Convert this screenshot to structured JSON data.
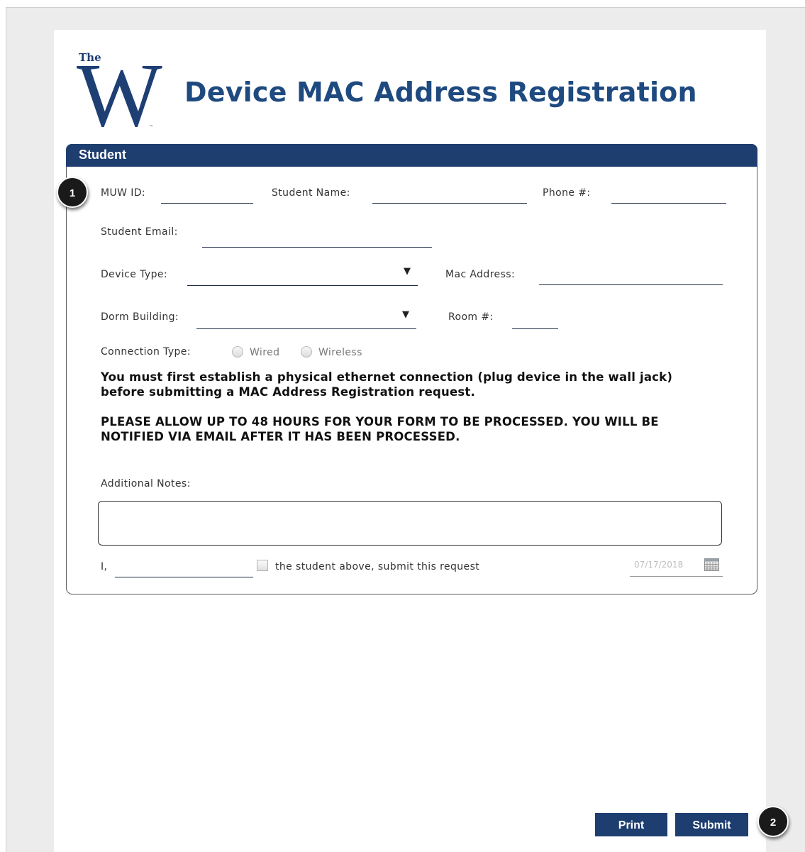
{
  "logo": {
    "top_word": "The",
    "letter": "W",
    "trademark": "™"
  },
  "page_title": "Device MAC Address Registration",
  "panel": {
    "header": "Student"
  },
  "fields": {
    "muw_id_label": "MUW ID:",
    "student_name_label": "Student Name:",
    "phone_label": "Phone #:",
    "student_email_label": "Student Email:",
    "device_type_label": "Device Type:",
    "mac_address_label": "Mac Address:",
    "dorm_building_label": "Dorm Building:",
    "room_label": "Room #:",
    "connection_type_label": "Connection Type:",
    "wired_label": "Wired",
    "wireless_label": "Wireless",
    "additional_notes_label": "Additional Notes:",
    "signature_prefix": "I,",
    "agree_label": "the student above, submit this request",
    "date_value": "07/17/2018"
  },
  "notices": {
    "ethernet_line1": "You must first establish a physical ethernet connection (plug device in the wall jack)",
    "ethernet_line2": "before submitting a MAC Address Registration request.",
    "processing_line1": "PLEASE ALLOW UP TO 48 HOURS FOR YOUR FORM TO BE PROCESSED.  YOU WILL BE",
    "processing_line2": "NOTIFIED VIA EMAIL AFTER IT HAS BEEN PROCESSED."
  },
  "buttons": {
    "print": "Print",
    "submit": "Submit"
  },
  "markers": {
    "one": "1",
    "two": "2"
  },
  "colors": {
    "brand_navy": "#1d3e6f",
    "title_blue": "#1e4a80"
  },
  "icons": {
    "dropdown": "chevron-down-icon",
    "calendar": "calendar-icon"
  }
}
